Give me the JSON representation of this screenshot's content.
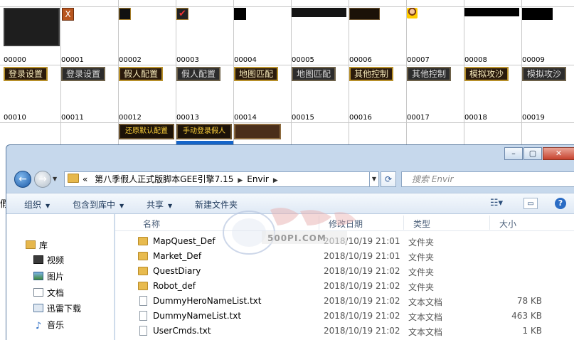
{
  "grid": {
    "labels": [
      "00000",
      "00001",
      "00002",
      "00003",
      "00004",
      "00005",
      "00006",
      "00007",
      "00008",
      "00009",
      "00010",
      "00011",
      "00012",
      "00013",
      "00014",
      "00015",
      "00016",
      "00017",
      "00018",
      "00019"
    ],
    "buttons": [
      "登录设置",
      "登录设置",
      "假人配置",
      "假人配置",
      "地图匹配",
      "地图匹配",
      "其他控制",
      "其他控制",
      "模拟攻沙",
      "模拟攻沙"
    ],
    "row3_buttons": [
      "还原默认配置",
      "手动登录假人"
    ],
    "partial_char": "假"
  },
  "window": {
    "address": {
      "chevron": "«",
      "segments": [
        "第八季假人正式版脚本GEE引擎7.15",
        "Envir"
      ]
    },
    "search_placeholder": "搜索 Envir",
    "toolbar": {
      "organize": "组织",
      "include": "包含到库中",
      "share": "共享",
      "new_folder": "新建文件夹"
    },
    "nav": {
      "library": "库",
      "items": [
        "视频",
        "图片",
        "文档",
        "迅雷下载",
        "音乐"
      ]
    },
    "columns": {
      "name": "名称",
      "date": "修改日期",
      "type": "类型",
      "size": "大小"
    },
    "files": [
      {
        "name": "MapQuest_Def",
        "date": "2018/10/19 21:01",
        "type": "文件夹",
        "size": "",
        "kind": "folder"
      },
      {
        "name": "Market_Def",
        "date": "2018/10/19 21:01",
        "type": "文件夹",
        "size": "",
        "kind": "folder"
      },
      {
        "name": "QuestDiary",
        "date": "2018/10/19 21:02",
        "type": "文件夹",
        "size": "",
        "kind": "folder"
      },
      {
        "name": "Robot_def",
        "date": "2018/10/19 21:02",
        "type": "文件夹",
        "size": "",
        "kind": "folder"
      },
      {
        "name": "DummyHeroNameList.txt",
        "date": "2018/10/19 21:02",
        "type": "文本文档",
        "size": "78 KB",
        "kind": "txt"
      },
      {
        "name": "DummyNameList.txt",
        "date": "2018/10/19 21:02",
        "type": "文本文档",
        "size": "463 KB",
        "kind": "txt"
      },
      {
        "name": "UserCmds.txt",
        "date": "2018/10/19 21:02",
        "type": "文本文档",
        "size": "1 KB",
        "kind": "txt"
      }
    ]
  },
  "watermark": {
    "site": "500PI.COM"
  },
  "colors": {
    "accent": "#1464c8",
    "gold_border": "#b8902a",
    "window_frame": "#c6d8ec"
  }
}
